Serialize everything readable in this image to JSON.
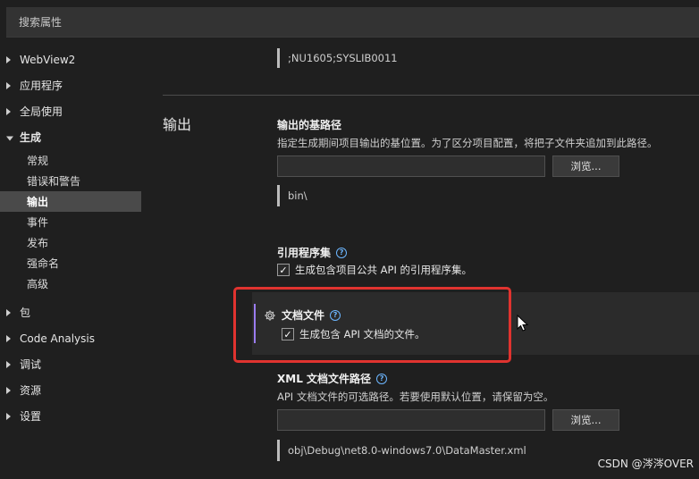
{
  "search": {
    "placeholder": "搜索属性"
  },
  "sidebar": {
    "items": [
      {
        "label": "WebView2",
        "state": "collapsed"
      },
      {
        "label": "应用程序",
        "state": "collapsed"
      },
      {
        "label": "全局使用",
        "state": "collapsed"
      },
      {
        "label": "生成",
        "state": "expanded"
      },
      {
        "label": "包",
        "state": "collapsed"
      },
      {
        "label": "Code Analysis",
        "state": "collapsed"
      },
      {
        "label": "调试",
        "state": "collapsed"
      },
      {
        "label": "资源",
        "state": "collapsed"
      },
      {
        "label": "设置",
        "state": "collapsed"
      }
    ],
    "build_children": [
      "常规",
      "错误和警告",
      "输出",
      "事件",
      "发布",
      "强命名",
      "高级"
    ],
    "selected": "输出"
  },
  "top_value": ";NU1605;SYSLIB0011",
  "section": {
    "title": "输出"
  },
  "base_output": {
    "title": "输出的基路径",
    "desc": "指定生成期间项目输出的基位置。为了区分项目配置，将把子文件夹追加到此路径。",
    "value": "",
    "browse_label": "浏览...",
    "resolved": "bin\\"
  },
  "ref_assembly": {
    "title": "引用程序集",
    "checkbox_label": "生成包含项目公共 API 的引用程序集。",
    "checked": true
  },
  "doc_file": {
    "title": "文档文件",
    "checkbox_label": "生成包含 API 文档的文件。",
    "checked": true
  },
  "xml_path": {
    "title": "XML 文档文件路径",
    "desc": "API 文档文件的可选路径。若要使用默认位置，请保留为空。",
    "value": "",
    "browse_label": "浏览...",
    "resolved": "obj\\Debug\\net8.0-windows7.0\\DataMaster.xml"
  },
  "watermark": "CSDN @涔涔OVER",
  "colors": {
    "accent_purple": "#9a7cf0",
    "help_blue": "#6cb6ff",
    "highlight_red": "#e0332f",
    "selected_bg": "#4a4a4a"
  }
}
